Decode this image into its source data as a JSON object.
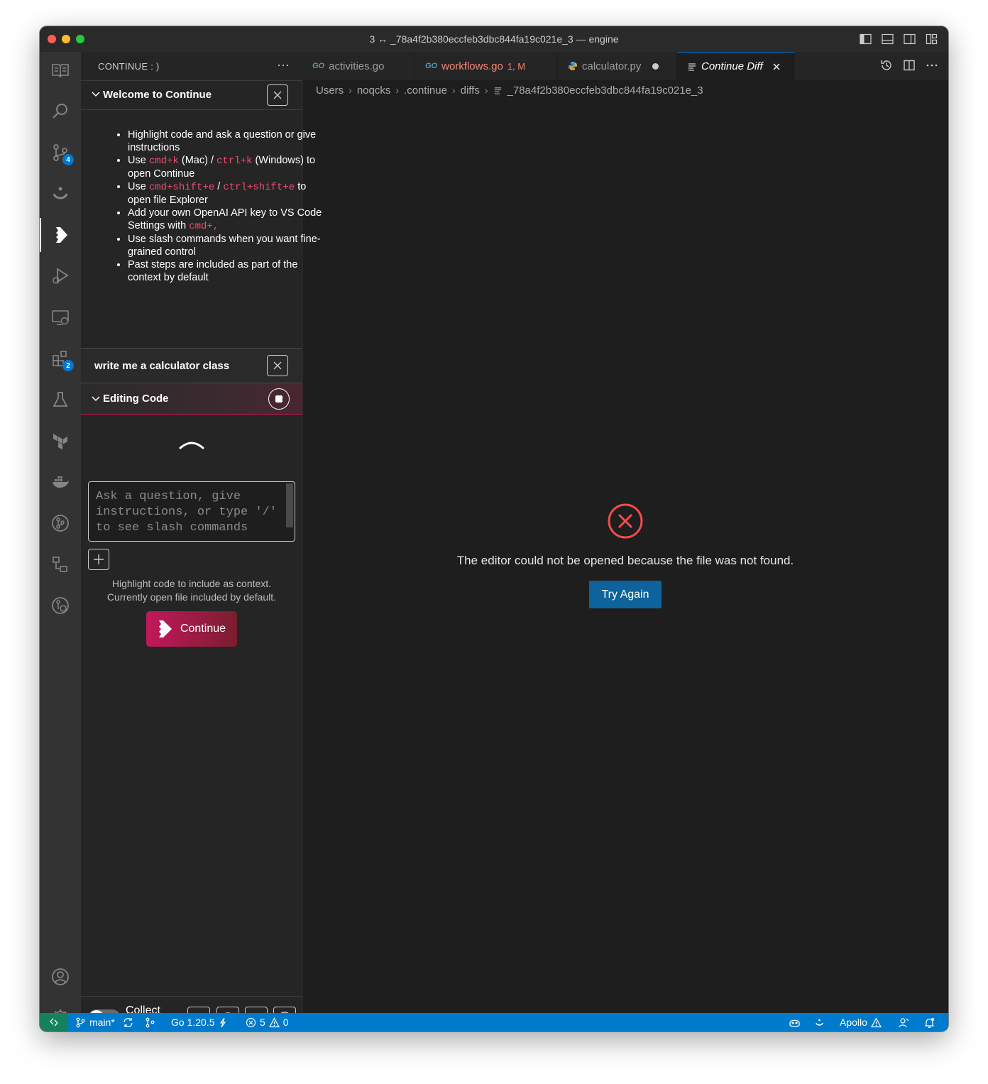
{
  "window": {
    "title": "3 ↔ _78a4f2b380eccfeb3dbc844fa19c021e_3 — engine"
  },
  "activity_bar": {
    "source_control_badge": "4",
    "extensions_badge": "2"
  },
  "sidebar": {
    "title": "CONTINUE : )",
    "more": "···",
    "welcome": {
      "title": "Welcome to Continue",
      "items": [
        {
          "parts": [
            {
              "text": "Highlight code and ask a question or give instructions"
            }
          ]
        },
        {
          "parts": [
            {
              "text": "Use "
            },
            {
              "kbd": "cmd+k"
            },
            {
              "text": " (Mac) / "
            },
            {
              "kbd": "ctrl+k"
            },
            {
              "text": " (Windows) to open Continue"
            }
          ]
        },
        {
          "parts": [
            {
              "text": "Use "
            },
            {
              "kbd": "cmd+shift+e"
            },
            {
              "text": " / "
            },
            {
              "kbd": "ctrl+shift+e"
            },
            {
              "text": " to open file Explorer"
            }
          ]
        },
        {
          "parts": [
            {
              "text": "Add your own OpenAI API key to VS Code Settings with "
            },
            {
              "kbd": "cmd+,"
            }
          ]
        },
        {
          "parts": [
            {
              "text": "Use slash commands when you want fine-grained control"
            }
          ]
        },
        {
          "parts": [
            {
              "text": "Past steps are included as part of the context by default"
            }
          ]
        }
      ]
    },
    "step": {
      "title": "write me a calculator class"
    },
    "editing": {
      "title": "Editing Code"
    },
    "input": {
      "placeholder": "Ask a question, give instructions, or type '/' to see slash commands"
    },
    "hint_line1": "Highlight code to include as context.",
    "hint_line2": "Currently open file included by default.",
    "continue_label": "Continue",
    "footer": {
      "collect_data": "Collect Data",
      "toggle_mark": "✖"
    }
  },
  "tabs": [
    {
      "name": "activities.go",
      "icon": "GO",
      "kind": "go"
    },
    {
      "name": "workflows.go",
      "icon": "GO",
      "kind": "go",
      "badge": "1, M"
    },
    {
      "name": "calculator.py",
      "icon": "python-icon",
      "kind": "py",
      "dirty": true
    },
    {
      "name": "Continue Diff",
      "icon": "file-lines-icon",
      "active": true
    }
  ],
  "breadcrumbs": [
    "Users",
    "noqcks",
    ".continue",
    "diffs",
    "_78a4f2b380eccfeb3dbc844fa19c021e_3"
  ],
  "editor": {
    "error_message": "The editor could not be opened because the file was not found.",
    "try_again": "Try Again"
  },
  "statusbar": {
    "branch": "main*",
    "go_version": "Go 1.20.5",
    "errors": "5",
    "warnings": "0",
    "apollo": "Apollo"
  },
  "colors": {
    "accent": "#007acc",
    "continue_pink": "#c2185b",
    "error_red": "#f14c4c",
    "try_button": "#0e639c"
  }
}
